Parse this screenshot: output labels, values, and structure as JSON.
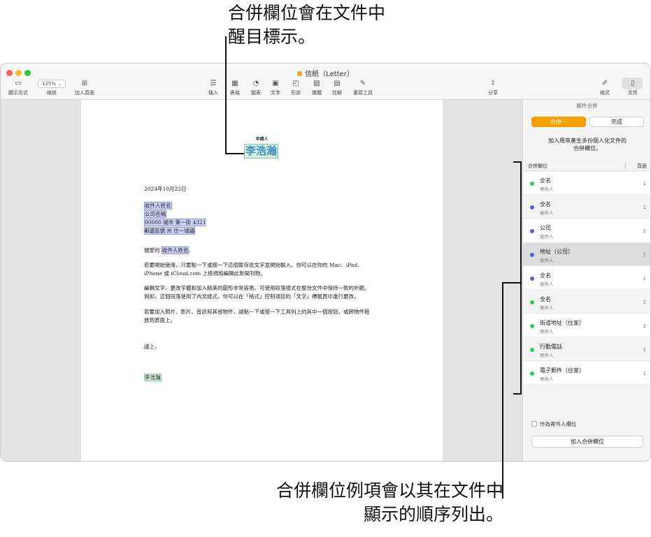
{
  "callouts": {
    "top_line1": "合併欄位會在文件中",
    "top_line2": "醒目標示。",
    "bottom_line1": "合併欄位例項會以其在文件中",
    "bottom_line2": "顯示的順序列出。"
  },
  "window": {
    "title": "信紙（Letter）",
    "colors": {
      "close": "#ff5f57",
      "minimize": "#febc2e",
      "zoom": "#28c840",
      "accent": "#f5a000"
    }
  },
  "toolbar": {
    "view": {
      "icon": "sidebar-icon",
      "label": "顯示方式"
    },
    "zoom": {
      "value": "125%",
      "label": "縮放"
    },
    "add_page": {
      "icon": "plus-square-icon",
      "label": "加入頁面"
    },
    "insert": {
      "icon": "list-icon",
      "label": "插入"
    },
    "table": {
      "icon": "table-icon",
      "label": "表格"
    },
    "chart": {
      "icon": "chart-icon",
      "label": "圖表"
    },
    "text": {
      "icon": "text-box-icon",
      "label": "文字"
    },
    "shape": {
      "icon": "shape-icon",
      "label": "形狀"
    },
    "media": {
      "icon": "media-icon",
      "label": "媒體"
    },
    "comment": {
      "icon": "comment-icon",
      "label": "註解"
    },
    "writing_tools": {
      "icon": "writing-tools-icon",
      "label": "書寫工具"
    },
    "share": {
      "icon": "share-icon",
      "label": "分享"
    },
    "format": {
      "icon": "paintbrush-icon",
      "label": "格式"
    },
    "document": {
      "icon": "document-icon",
      "label": "文件"
    }
  },
  "letter": {
    "sender_label": "申請人",
    "sender_name": "李浩瀚",
    "date": "2024年10月22日",
    "recipient_name": "收件人姓名",
    "company": "公司名稱",
    "address_line": "00000 城市 第一街 4321",
    "address_line2": "郵遞區號 州 住一城議",
    "greeting_prefix": "親愛的",
    "greeting_field": "收件人姓名",
    "greeting_suffix": ",",
    "para1_line1": "若要開始使用，只要點一下或按一下這個暫存區文字並開始輸入。你可以在你的 Mac、iPad、",
    "para1_line2": "iPhone 或 iCloud.com 上檢視和編輯此新聞刊物。",
    "para2_line1": "編輯文字、更改字體和加入精美的圖形非常容易。可使用段落樣式在整份文件中保持一致的外觀。",
    "para2_line2": "例如，這個段落使用了內文樣式，你可以在「格式」控制項目的「文字」標籤頁中進行更改。",
    "para3_line1": "若要加入照片、影片、音訊和其他物件，請點一下或按一下工具列上的其中一個按鈕，或將物件拖",
    "para3_line2": "放到頁面上。",
    "closing": "謹上，",
    "signature": "李浩瀚"
  },
  "sidebar": {
    "header": "郵件合併",
    "merge_button": "合併⋯",
    "done_button": "完成",
    "description_line1": "加入用來產生多份個人化文件的",
    "description_line2": "合併欄位。",
    "col_field": "合併欄位",
    "col_page": "頁面",
    "fields": [
      {
        "name": "全名",
        "type": "寄件人",
        "page": "1",
        "color": "green"
      },
      {
        "name": "全名",
        "type": "收件人",
        "page": "1",
        "color": "blue"
      },
      {
        "name": "公司",
        "type": "收件人",
        "page": "1",
        "color": "blue"
      },
      {
        "name": "地址（公司）",
        "type": "收件人",
        "page": "1",
        "color": "blue"
      },
      {
        "name": "全名",
        "type": "收件人",
        "page": "1",
        "color": "blue"
      },
      {
        "name": "全名",
        "type": "寄件人",
        "page": "1",
        "color": "green"
      },
      {
        "name": "街道地址（住家）",
        "type": "寄件人",
        "page": "1",
        "color": "green"
      },
      {
        "name": "行動電話",
        "type": "寄件人",
        "page": "1",
        "color": "green"
      },
      {
        "name": "電子郵件（住家）",
        "type": "寄件人",
        "page": "1",
        "color": "green"
      }
    ],
    "checkbox_label": "作為寄件人欄位",
    "add_field_button": "加入合併欄位"
  }
}
